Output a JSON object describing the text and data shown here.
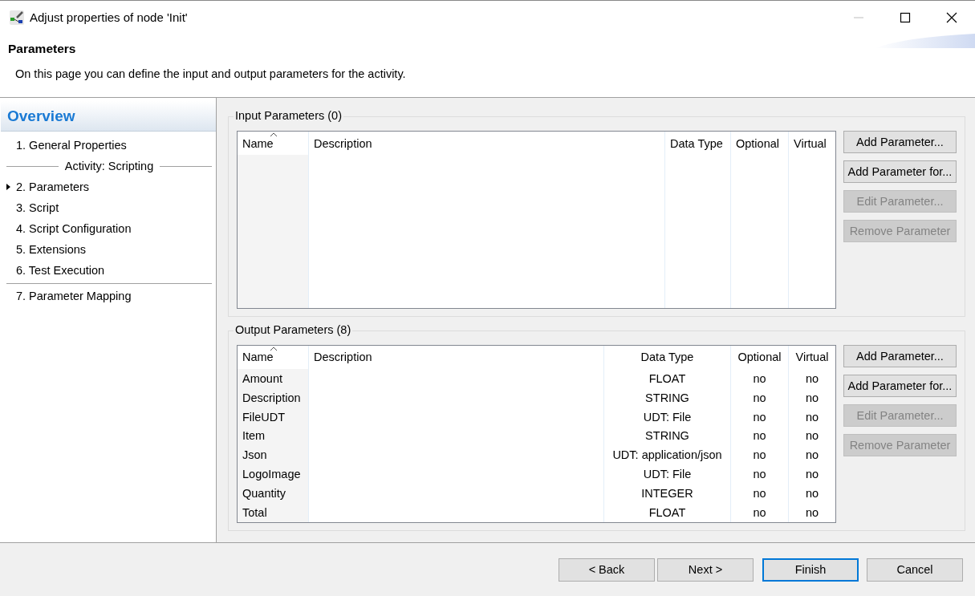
{
  "window": {
    "title": "Adjust properties of node 'Init'",
    "controls": [
      {
        "kind": "minimize",
        "disabled": true
      },
      {
        "kind": "maximize",
        "disabled": false
      },
      {
        "kind": "close",
        "disabled": false
      }
    ]
  },
  "header": {
    "title": "Parameters",
    "description": "On this page you can define the input and output parameters for the activity."
  },
  "sidebar": {
    "title": "Overview",
    "items": [
      {
        "kind": "item",
        "label": "1. General Properties",
        "selected": false
      },
      {
        "kind": "section",
        "label": "Activity: Scripting"
      },
      {
        "kind": "item",
        "label": "2. Parameters",
        "selected": true
      },
      {
        "kind": "item",
        "label": "3. Script",
        "selected": false
      },
      {
        "kind": "item",
        "label": "4. Script Configuration",
        "selected": false
      },
      {
        "kind": "item",
        "label": "5. Extensions",
        "selected": false
      },
      {
        "kind": "item",
        "label": "6. Test Execution",
        "selected": false
      },
      {
        "kind": "divider"
      },
      {
        "kind": "item",
        "label": "7. Parameter Mapping",
        "selected": false
      }
    ]
  },
  "groups": [
    {
      "title": "Input Parameters (0)",
      "table": {
        "columns": [
          {
            "label": "Name",
            "sorted": true
          },
          {
            "label": "Description",
            "sorted": false
          },
          {
            "label": "Data Type",
            "sorted": false
          },
          {
            "label": "Optional",
            "sorted": false
          },
          {
            "label": "Virtual",
            "sorted": false
          }
        ]
      },
      "buttons": [
        {
          "label": "Add Parameter...",
          "disabled": false
        },
        {
          "label": "Add Parameter for...",
          "disabled": false
        },
        {
          "label": "Edit Parameter...",
          "disabled": true
        },
        {
          "label": "Remove Parameter",
          "disabled": true
        }
      ]
    },
    {
      "title": "Output Parameters (8)",
      "table": {
        "columns": [
          {
            "label": "Name",
            "sorted": true
          },
          {
            "label": "Description",
            "sorted": false
          },
          {
            "label": "Data Type",
            "sorted": false
          },
          {
            "label": "Optional",
            "sorted": false
          },
          {
            "label": "Virtual",
            "sorted": false
          }
        ],
        "rows": [
          [
            "Amount",
            "",
            "FLOAT",
            "no",
            "no"
          ],
          [
            "Description",
            "",
            "STRING",
            "no",
            "no"
          ],
          [
            "FileUDT",
            "",
            "UDT: File",
            "no",
            "no"
          ],
          [
            "Item",
            "",
            "STRING",
            "no",
            "no"
          ],
          [
            "Json",
            "",
            "UDT: application/json",
            "no",
            "no"
          ],
          [
            "LogoImage",
            "",
            "UDT: File",
            "no",
            "no"
          ],
          [
            "Quantity",
            "",
            "INTEGER",
            "no",
            "no"
          ],
          [
            "Total",
            "",
            "FLOAT",
            "no",
            "no"
          ]
        ]
      },
      "buttons": [
        {
          "label": "Add Parameter...",
          "disabled": false
        },
        {
          "label": "Add Parameter for...",
          "disabled": false
        },
        {
          "label": "Edit Parameter...",
          "disabled": true
        },
        {
          "label": "Remove Parameter",
          "disabled": true
        }
      ]
    }
  ],
  "footer": {
    "buttons": [
      {
        "label": "< Back",
        "default": false
      },
      {
        "label": "Next >",
        "default": false
      },
      {
        "label": "Finish",
        "default": true
      },
      {
        "label": "Cancel",
        "default": false
      }
    ]
  }
}
